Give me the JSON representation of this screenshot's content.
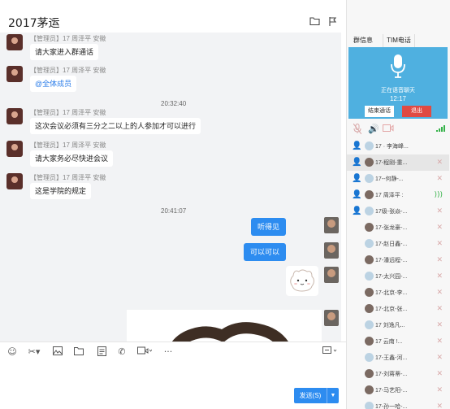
{
  "window": {
    "title": "2017茅运",
    "edit_icon": "pencil-icon",
    "toolbar_icons": [
      "folder-icon",
      "flag-icon",
      "book-icon",
      "image-icon",
      "apps-icon",
      "add-window-icon",
      "gear-icon"
    ]
  },
  "messages": [
    {
      "sender": "【管理员】17 周泽平 安徽",
      "text": "请大家进入群通话",
      "style": "normal"
    },
    {
      "sender": "【管理员】17 周泽平 安徽",
      "text": "@全体成员",
      "style": "link"
    },
    {
      "timestamp": "20:32:40"
    },
    {
      "sender": "【管理员】17 周泽平 安徽",
      "text": "这次会议必须有三分之二以上的人参加才可以进行",
      "style": "normal"
    },
    {
      "sender": "【管理员】17 周泽平 安徽",
      "text": "请大家务必尽快进会议",
      "style": "normal"
    },
    {
      "sender": "【管理员】17 周泽平 安徽",
      "text": "这是学院的规定",
      "style": "normal"
    },
    {
      "timestamp": "20:41:07"
    }
  ],
  "my_messages": [
    "听得见",
    "可以可以"
  ],
  "input_toolbar": {
    "icons": [
      "emoji-icon",
      "scissors-icon",
      "image-icon",
      "folder-icon",
      "document-icon",
      "phone-icon",
      "video-icon",
      "more-icon",
      "tips-icon"
    ]
  },
  "send_button": {
    "label": "发送(S)"
  },
  "side_panel": {
    "tabs": [
      "群信息",
      "TIM电话"
    ],
    "call_status": "正在语音聊天",
    "call_time": "12:17",
    "end_call_label": "结束通话",
    "leave_label": "退出",
    "members": [
      {
        "name": "17 · 李海峰...",
        "icon": "admin-icon",
        "status": "none"
      },
      {
        "name": "17-程刚-重...",
        "icon": "user-icon",
        "status": "muted"
      },
      {
        "name": "17--何静-...",
        "icon": "user-icon",
        "status": "muted"
      },
      {
        "name": "17 周泽平 :",
        "icon": "user-icon",
        "status": "speaking"
      },
      {
        "name": "17级-张焱-...",
        "icon": "user-icon",
        "status": "muted"
      },
      {
        "name": "17-张龙豪-...",
        "icon": "none",
        "status": "muted"
      },
      {
        "name": "17-赵日鑫-...",
        "icon": "none",
        "status": "muted"
      },
      {
        "name": "17-潘远程-...",
        "icon": "none",
        "status": "muted"
      },
      {
        "name": "17-太兴园-...",
        "icon": "none",
        "status": "muted"
      },
      {
        "name": "17-北京-李...",
        "icon": "none",
        "status": "muted"
      },
      {
        "name": "17-北京-张...",
        "icon": "none",
        "status": "muted"
      },
      {
        "name": "17 刘逸凡...",
        "icon": "none",
        "status": "muted"
      },
      {
        "name": "17 云南 !...",
        "icon": "none",
        "status": "muted"
      },
      {
        "name": "17-王鑫-河...",
        "icon": "none",
        "status": "muted"
      },
      {
        "name": "17-刘蒋蒂-...",
        "icon": "none",
        "status": "muted"
      },
      {
        "name": "17-马艺阳-...",
        "icon": "none",
        "status": "muted"
      },
      {
        "name": "17-孙一哈-...",
        "icon": "none",
        "status": "muted"
      }
    ]
  }
}
